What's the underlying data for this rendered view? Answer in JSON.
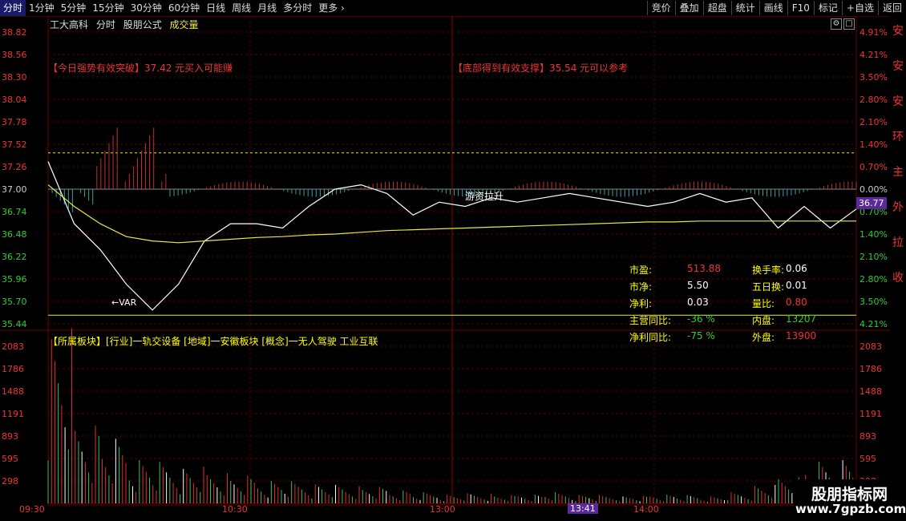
{
  "toolbar": {
    "left_items": [
      "分时",
      "1分钟",
      "5分钟",
      "15分钟",
      "30分钟",
      "60分钟",
      "日线",
      "周线",
      "月线",
      "多分时",
      "更多"
    ],
    "right_items": [
      "竞价",
      "叠加",
      "超盘",
      "统计",
      "画线",
      "F10",
      "标记",
      "+自选",
      "返回"
    ],
    "more_icon": "chevron-right-icon"
  },
  "title": {
    "stock": "工大高科",
    "mode": "分时",
    "formula": "股朋公式",
    "volume": "成交量"
  },
  "price_axis": {
    "left": [
      "38.82",
      "38.56",
      "38.30",
      "38.04",
      "37.78",
      "37.52",
      "37.26",
      "37.00",
      "36.74",
      "36.48",
      "36.22",
      "35.96",
      "35.70",
      "35.44"
    ],
    "right": [
      "4.91%",
      "4.21%",
      "3.50%",
      "2.80%",
      "2.10%",
      "1.40%",
      "0.70%",
      "0.00%",
      "0.70%",
      "1.40%",
      "2.10%",
      "2.80%",
      "3.50%",
      "4.21%"
    ]
  },
  "volume_axis": [
    "2083",
    "1786",
    "1488",
    "1191",
    "893",
    "595",
    "298"
  ],
  "annotations": {
    "left_text": "【今日强势有效突破】37.42 元买入可能赚",
    "right_text": "【底部得到有效支撑】35.54 元可以参考",
    "pull_label": "游资拉升",
    "var_label": "←VAR"
  },
  "info_panel": {
    "items": [
      {
        "label": "市盈:",
        "value": "513.88",
        "label2": "换手率:",
        "value2": "0.06"
      },
      {
        "label": "市净:",
        "value": "5.50",
        "label2": "五日换:",
        "value2": "0.01"
      },
      {
        "label": "净利:",
        "value": "0.03",
        "label2": "量比:",
        "value2": "0.80"
      },
      {
        "label": "主营同比:",
        "value": "-36 %",
        "label2": "内盘:",
        "value2": "13207"
      },
      {
        "label": "净利同比:",
        "value": "-75 %",
        "label2": "外盘:",
        "value2": "13900"
      }
    ]
  },
  "board_text": "【所属板块】[行业]一轨交设备 [地域]一安徽板块 [概念]一无人驾驶 工业互联",
  "time_axis": [
    "09:30",
    "10:30",
    "13:00",
    "14:00"
  ],
  "current_time": "13:41",
  "current_price": "36.77",
  "brand": {
    "line1": "股朋指标网",
    "line2": "www.7gpzb.com"
  },
  "right_strip_chars": [
    "安",
    "安",
    "安",
    "环",
    "主",
    "外",
    "拉",
    "收"
  ],
  "chart_data": {
    "type": "line",
    "title": "",
    "xlabel": "",
    "ylabel": "",
    "ylim": [
      35.44,
      38.82
    ],
    "prev_close": 37.0,
    "x": [
      "09:30",
      "09:35",
      "09:40",
      "09:45",
      "09:50",
      "09:55",
      "10:00",
      "10:05",
      "10:10",
      "10:15",
      "10:20",
      "10:25",
      "10:30",
      "10:40",
      "10:50",
      "11:00",
      "11:10",
      "11:20",
      "11:30",
      "13:00",
      "13:10",
      "13:20",
      "13:30",
      "13:41",
      "13:50",
      "14:00",
      "14:10",
      "14:20",
      "14:30",
      "14:40",
      "14:50",
      "15:00"
    ],
    "series": [
      {
        "values": [
          37.32,
          36.6,
          36.3,
          35.9,
          35.6,
          35.9,
          36.4,
          36.6,
          36.6,
          36.55,
          36.8,
          37.0,
          37.05,
          36.95,
          36.7,
          36.85,
          36.8,
          36.9,
          36.85,
          36.9,
          36.95,
          36.9,
          36.85,
          36.8,
          36.85,
          36.95,
          36.85,
          36.9,
          36.55,
          36.8,
          36.55,
          36.77
        ],
        "color": "#ffffff"
      },
      {
        "values": [
          37.05,
          36.8,
          36.6,
          36.45,
          36.4,
          36.38,
          36.4,
          36.42,
          36.44,
          36.45,
          36.47,
          36.48,
          36.5,
          36.52,
          36.53,
          36.54,
          36.55,
          36.56,
          36.57,
          36.58,
          36.59,
          36.6,
          36.61,
          36.62,
          36.62,
          36.63,
          36.63,
          36.63,
          36.63,
          36.63,
          36.63,
          36.63
        ],
        "color": "#e8e84a"
      }
    ],
    "volume_values": [
      1900,
      900,
      700,
      500,
      450,
      400,
      350,
      300,
      260,
      240,
      220,
      200,
      180,
      150,
      120,
      100,
      110,
      90,
      100,
      120,
      100,
      90,
      80,
      100,
      90,
      80,
      120,
      200,
      300,
      450,
      500,
      350
    ],
    "volume_ylim": [
      0,
      2083
    ]
  }
}
